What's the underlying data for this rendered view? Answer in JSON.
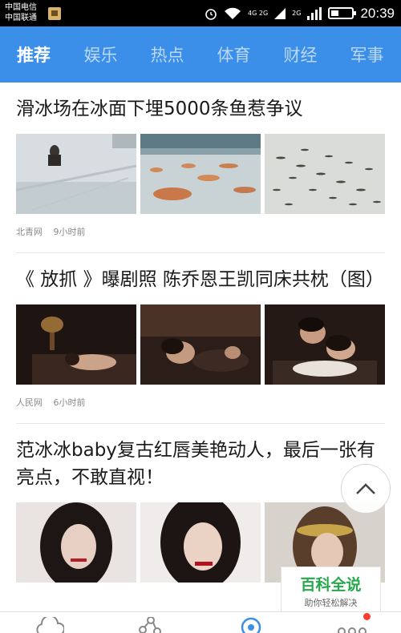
{
  "status_bar": {
    "carrier1": "中国电信",
    "carrier2": "中国联通",
    "net_top": "4G 2G",
    "net_bottom": "2G",
    "time": "20:39"
  },
  "tabs": [
    {
      "label": "推荐",
      "active": true
    },
    {
      "label": "娱乐",
      "active": false
    },
    {
      "label": "热点",
      "active": false
    },
    {
      "label": "体育",
      "active": false
    },
    {
      "label": "财经",
      "active": false
    },
    {
      "label": "军事",
      "active": false
    }
  ],
  "articles": [
    {
      "title": "滑冰场在冰面下埋5000条鱼惹争议",
      "source": "北青网",
      "time": "9小时前"
    },
    {
      "title": "《 放抓 》曝剧照 陈乔恩王凯同床共枕（图）",
      "source": "人民网",
      "time": "6小时前"
    },
    {
      "title": "范冰冰baby复古红唇美艳动人，最后一张有亮点，不敢直视！",
      "source": "",
      "time": ""
    }
  ],
  "watermark": {
    "title": "百科全说",
    "subtitle": "助你轻松解决"
  },
  "colors": {
    "tab_bar": "#3b8fe8",
    "watermark_green": "#27a84a",
    "notification_dot": "#ff3b30"
  }
}
